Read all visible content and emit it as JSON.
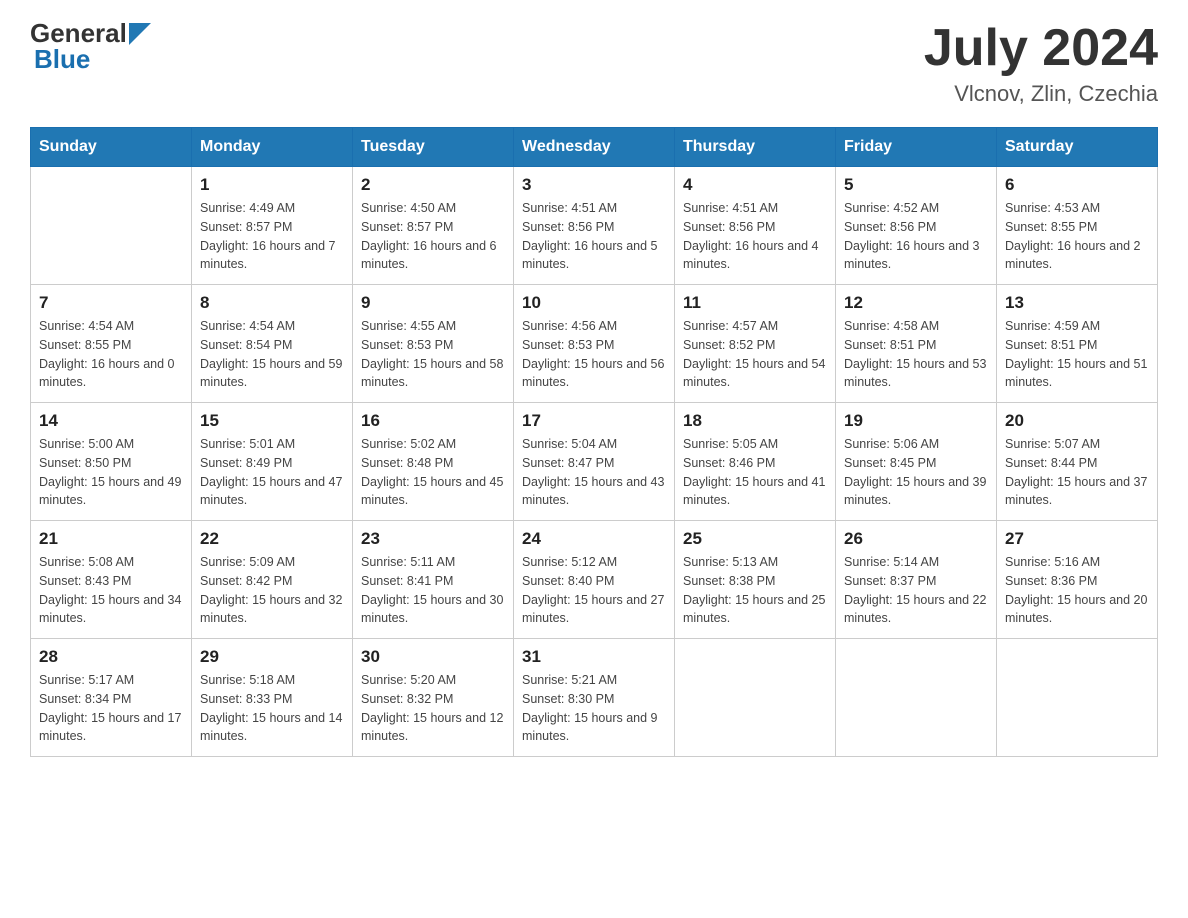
{
  "header": {
    "logo": {
      "general": "General",
      "blue": "Blue"
    },
    "title": "July 2024",
    "location": "Vlcnov, Zlin, Czechia"
  },
  "weekdays": [
    "Sunday",
    "Monday",
    "Tuesday",
    "Wednesday",
    "Thursday",
    "Friday",
    "Saturday"
  ],
  "weeks": [
    [
      null,
      {
        "day": "1",
        "sunrise": "4:49 AM",
        "sunset": "8:57 PM",
        "daylight": "16 hours and 7 minutes."
      },
      {
        "day": "2",
        "sunrise": "4:50 AM",
        "sunset": "8:57 PM",
        "daylight": "16 hours and 6 minutes."
      },
      {
        "day": "3",
        "sunrise": "4:51 AM",
        "sunset": "8:56 PM",
        "daylight": "16 hours and 5 minutes."
      },
      {
        "day": "4",
        "sunrise": "4:51 AM",
        "sunset": "8:56 PM",
        "daylight": "16 hours and 4 minutes."
      },
      {
        "day": "5",
        "sunrise": "4:52 AM",
        "sunset": "8:56 PM",
        "daylight": "16 hours and 3 minutes."
      },
      {
        "day": "6",
        "sunrise": "4:53 AM",
        "sunset": "8:55 PM",
        "daylight": "16 hours and 2 minutes."
      }
    ],
    [
      {
        "day": "7",
        "sunrise": "4:54 AM",
        "sunset": "8:55 PM",
        "daylight": "16 hours and 0 minutes."
      },
      {
        "day": "8",
        "sunrise": "4:54 AM",
        "sunset": "8:54 PM",
        "daylight": "15 hours and 59 minutes."
      },
      {
        "day": "9",
        "sunrise": "4:55 AM",
        "sunset": "8:53 PM",
        "daylight": "15 hours and 58 minutes."
      },
      {
        "day": "10",
        "sunrise": "4:56 AM",
        "sunset": "8:53 PM",
        "daylight": "15 hours and 56 minutes."
      },
      {
        "day": "11",
        "sunrise": "4:57 AM",
        "sunset": "8:52 PM",
        "daylight": "15 hours and 54 minutes."
      },
      {
        "day": "12",
        "sunrise": "4:58 AM",
        "sunset": "8:51 PM",
        "daylight": "15 hours and 53 minutes."
      },
      {
        "day": "13",
        "sunrise": "4:59 AM",
        "sunset": "8:51 PM",
        "daylight": "15 hours and 51 minutes."
      }
    ],
    [
      {
        "day": "14",
        "sunrise": "5:00 AM",
        "sunset": "8:50 PM",
        "daylight": "15 hours and 49 minutes."
      },
      {
        "day": "15",
        "sunrise": "5:01 AM",
        "sunset": "8:49 PM",
        "daylight": "15 hours and 47 minutes."
      },
      {
        "day": "16",
        "sunrise": "5:02 AM",
        "sunset": "8:48 PM",
        "daylight": "15 hours and 45 minutes."
      },
      {
        "day": "17",
        "sunrise": "5:04 AM",
        "sunset": "8:47 PM",
        "daylight": "15 hours and 43 minutes."
      },
      {
        "day": "18",
        "sunrise": "5:05 AM",
        "sunset": "8:46 PM",
        "daylight": "15 hours and 41 minutes."
      },
      {
        "day": "19",
        "sunrise": "5:06 AM",
        "sunset": "8:45 PM",
        "daylight": "15 hours and 39 minutes."
      },
      {
        "day": "20",
        "sunrise": "5:07 AM",
        "sunset": "8:44 PM",
        "daylight": "15 hours and 37 minutes."
      }
    ],
    [
      {
        "day": "21",
        "sunrise": "5:08 AM",
        "sunset": "8:43 PM",
        "daylight": "15 hours and 34 minutes."
      },
      {
        "day": "22",
        "sunrise": "5:09 AM",
        "sunset": "8:42 PM",
        "daylight": "15 hours and 32 minutes."
      },
      {
        "day": "23",
        "sunrise": "5:11 AM",
        "sunset": "8:41 PM",
        "daylight": "15 hours and 30 minutes."
      },
      {
        "day": "24",
        "sunrise": "5:12 AM",
        "sunset": "8:40 PM",
        "daylight": "15 hours and 27 minutes."
      },
      {
        "day": "25",
        "sunrise": "5:13 AM",
        "sunset": "8:38 PM",
        "daylight": "15 hours and 25 minutes."
      },
      {
        "day": "26",
        "sunrise": "5:14 AM",
        "sunset": "8:37 PM",
        "daylight": "15 hours and 22 minutes."
      },
      {
        "day": "27",
        "sunrise": "5:16 AM",
        "sunset": "8:36 PM",
        "daylight": "15 hours and 20 minutes."
      }
    ],
    [
      {
        "day": "28",
        "sunrise": "5:17 AM",
        "sunset": "8:34 PM",
        "daylight": "15 hours and 17 minutes."
      },
      {
        "day": "29",
        "sunrise": "5:18 AM",
        "sunset": "8:33 PM",
        "daylight": "15 hours and 14 minutes."
      },
      {
        "day": "30",
        "sunrise": "5:20 AM",
        "sunset": "8:32 PM",
        "daylight": "15 hours and 12 minutes."
      },
      {
        "day": "31",
        "sunrise": "5:21 AM",
        "sunset": "8:30 PM",
        "daylight": "15 hours and 9 minutes."
      },
      null,
      null,
      null
    ]
  ]
}
